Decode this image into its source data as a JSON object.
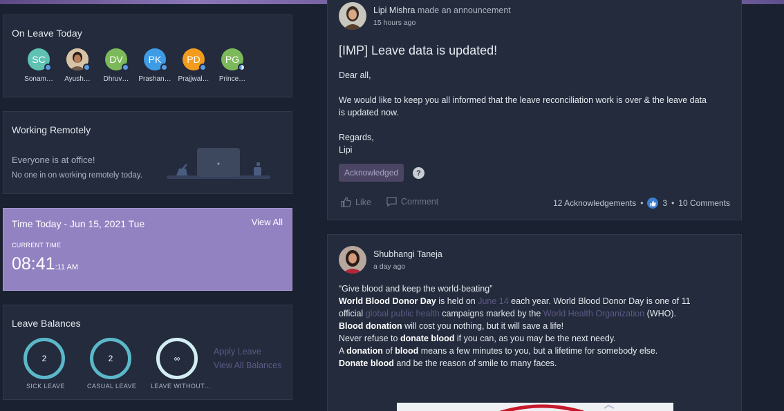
{
  "on_leave_today": {
    "title": "On Leave Today",
    "people": [
      {
        "initials": "SC",
        "name": "Sonam…",
        "color": "#5fc2b3",
        "photo": false
      },
      {
        "initials": "",
        "name": "Ayush…",
        "color": "#c69a6a",
        "photo": true
      },
      {
        "initials": "DV",
        "name": "Dhruv…",
        "color": "#7cb95a",
        "photo": false
      },
      {
        "initials": "PK",
        "name": "Prashan…",
        "color": "#3e9ce6",
        "photo": false
      },
      {
        "initials": "PD",
        "name": "Prajjwal…",
        "color": "#f29b1d",
        "photo": false
      },
      {
        "initials": "PG",
        "name": "Prince…",
        "color": "#7cb95a",
        "photo": false
      }
    ]
  },
  "working_remotely": {
    "title": "Working Remotely",
    "status": "Everyone is at office!",
    "subtitle": "No one in on working remotely today."
  },
  "time_today": {
    "title": "Time Today - Jun 15, 2021 Tue",
    "view_all": "View All",
    "current_label": "CURRENT TIME",
    "time_main": "08:41",
    "time_small": ":11 AM"
  },
  "leave_balances": {
    "title": "Leave Balances",
    "items": [
      {
        "value": "2",
        "label": "SICK LEAVE"
      },
      {
        "value": "2",
        "label": "CASUAL LEAVE"
      },
      {
        "value": "∞",
        "label": "LEAVE WITHOUT…"
      }
    ],
    "apply_leave": "Apply Leave",
    "view_all_balances": "View All Balances"
  },
  "post1": {
    "author": "Lipi Mishra",
    "action": "made an announcement",
    "time": "15 hours ago",
    "title": "[IMP] Leave data is updated!",
    "greeting": "Dear all,",
    "body_line1": "We would like to keep you all informed that the leave reconciliation work is over & the leave data",
    "body_line2": "is updated now.",
    "regards": "Regards,",
    "signoff": "Lipi",
    "ack_label": "Acknowledged",
    "help": "?",
    "like": "Like",
    "comment": "Comment",
    "ack_count": "12 Acknowledgements",
    "likes": "3",
    "comments": "10 Comments"
  },
  "post2": {
    "author": "Shubhangi Taneja",
    "time": "a day ago",
    "l1": "“Give blood and keep the world-beating”",
    "l2_b": "World Blood Donor Day",
    "l2_t1": " is held on ",
    "l2_link": "June 14",
    "l2_t2": " each year. World Blood Donor Day is one of 11",
    "l3_t1": "official ",
    "l3_link1": "global public health",
    "l3_t2": " campaigns marked by the ",
    "l3_link2": "World Health Organization",
    "l3_t3": " (WHO).",
    "l4_b": "Blood donation",
    "l4_t": " will cost you nothing, but it will save a life!",
    "l5_t1": "Never refuse to ",
    "l5_b": "donate blood",
    "l5_t2": " if you can, as you may be the next needy.",
    "l6_t1": "A ",
    "l6_b1": "donation",
    "l6_t2": " of ",
    "l6_b2": "blood",
    "l6_t3": " means a few minutes to you, but a lifetime for somebody else.",
    "l7_b": "Donate blood",
    "l7_t": " and be the reason of smile to many faces."
  },
  "colors": {
    "background": "#1a2130",
    "card": "#232b3c",
    "accent_purple": "#9282c2",
    "ring": "#5cb8c9",
    "link": "#5e5a86"
  }
}
